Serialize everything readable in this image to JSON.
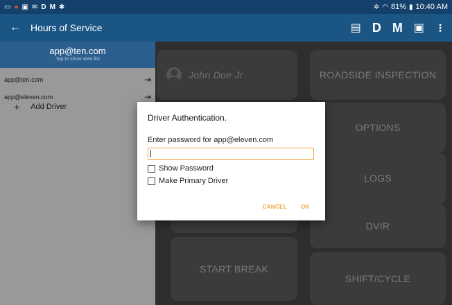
{
  "status_bar": {
    "left_icons": [
      "notification-icon",
      "alert-icon",
      "image-icon",
      "mail-icon",
      "D",
      "M",
      "settings-icon"
    ],
    "right_text": "81%",
    "time": "10:40 AM"
  },
  "appbar": {
    "title": "Hours of Service",
    "actions": [
      "chat-icon",
      "D",
      "M",
      "monitor-icon",
      "more-icon"
    ]
  },
  "drawer": {
    "header_email": "app@ten.com",
    "header_hint": "Tap to show view list",
    "drivers": [
      {
        "email": "app@ten.com"
      },
      {
        "email": "app@eleven.com"
      }
    ],
    "add_driver": "Add Driver"
  },
  "main": {
    "user_name": "John Doe Jr",
    "tiles": {
      "roadside": "ROADSIDE INSPECTION",
      "options": "OPTIONS",
      "logs": "LOGS",
      "dvir": "DVIR",
      "start_break": "START BREAK",
      "shift_cycle": "SHIFT/CYCLE"
    }
  },
  "dialog": {
    "title": "Driver Authentication.",
    "prompt": "Enter password for app@eleven.com",
    "password_value": "",
    "show_password": "Show Password",
    "make_primary": "Make Primary Driver",
    "cancel": "CANCEL",
    "ok": "OK"
  }
}
